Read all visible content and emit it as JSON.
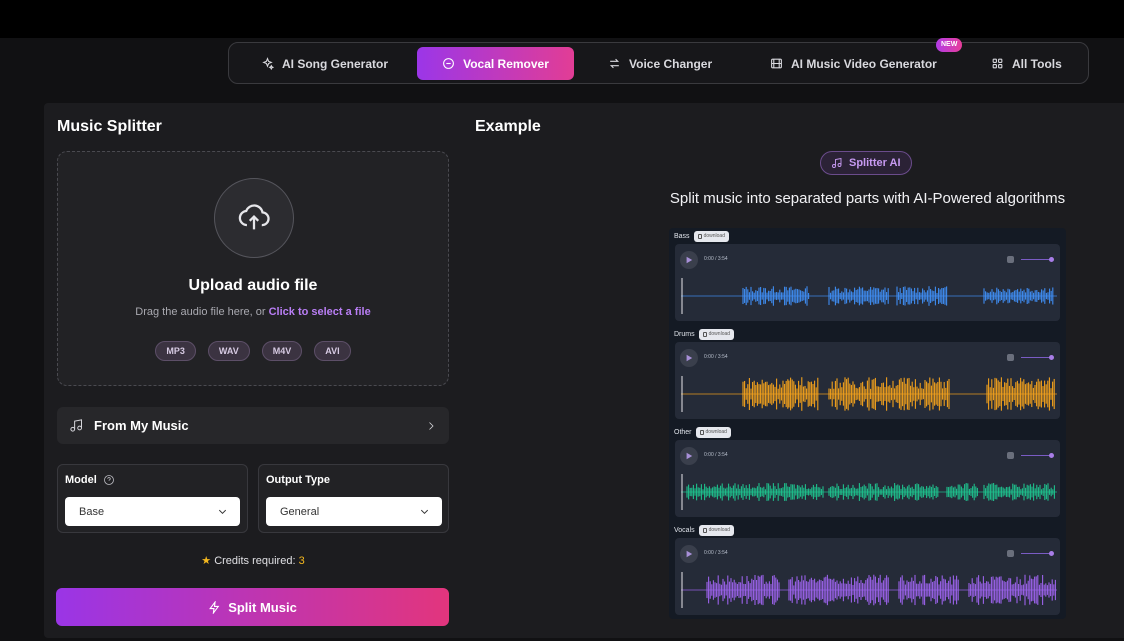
{
  "nav": {
    "items": [
      {
        "label": "AI Song Generator",
        "icon": "sparkle-icon"
      },
      {
        "label": "Vocal Remover",
        "icon": "minus-circle-icon",
        "active": true
      },
      {
        "label": "Voice Changer",
        "icon": "swap-icon"
      },
      {
        "label": "AI Music Video Generator",
        "icon": "film-icon",
        "badge": "NEW"
      },
      {
        "label": "All Tools",
        "icon": "grid-icon"
      }
    ]
  },
  "left": {
    "title": "Music Splitter",
    "upload": {
      "title": "Upload audio file",
      "hint": "Drag the audio file here, or",
      "link": "Click to select a file",
      "formats": [
        "MP3",
        "WAV",
        "M4V",
        "AVI"
      ]
    },
    "from_music": "From My Music",
    "model": {
      "label": "Model",
      "value": "Base"
    },
    "output": {
      "label": "Output Type",
      "value": "General"
    },
    "credits": {
      "label": "Credits required:",
      "value": "3"
    },
    "split_button": "Split Music"
  },
  "right": {
    "title": "Example",
    "badge": "Splitter AI",
    "subtitle": "Split music into separated parts with AI-Powered algorithms",
    "tracks": [
      {
        "name": "Bass",
        "download": "download",
        "time": "0:00 / 3:54",
        "color": "#3f8df2"
      },
      {
        "name": "Drums",
        "download": "download",
        "time": "0:00 / 3:54",
        "color": "#f2a11c"
      },
      {
        "name": "Other",
        "download": "download",
        "time": "0:00 / 3:54",
        "color": "#1fbf8c"
      },
      {
        "name": "Vocals",
        "download": "download",
        "time": "0:00 / 3:54",
        "color": "#9b62ea"
      }
    ]
  }
}
